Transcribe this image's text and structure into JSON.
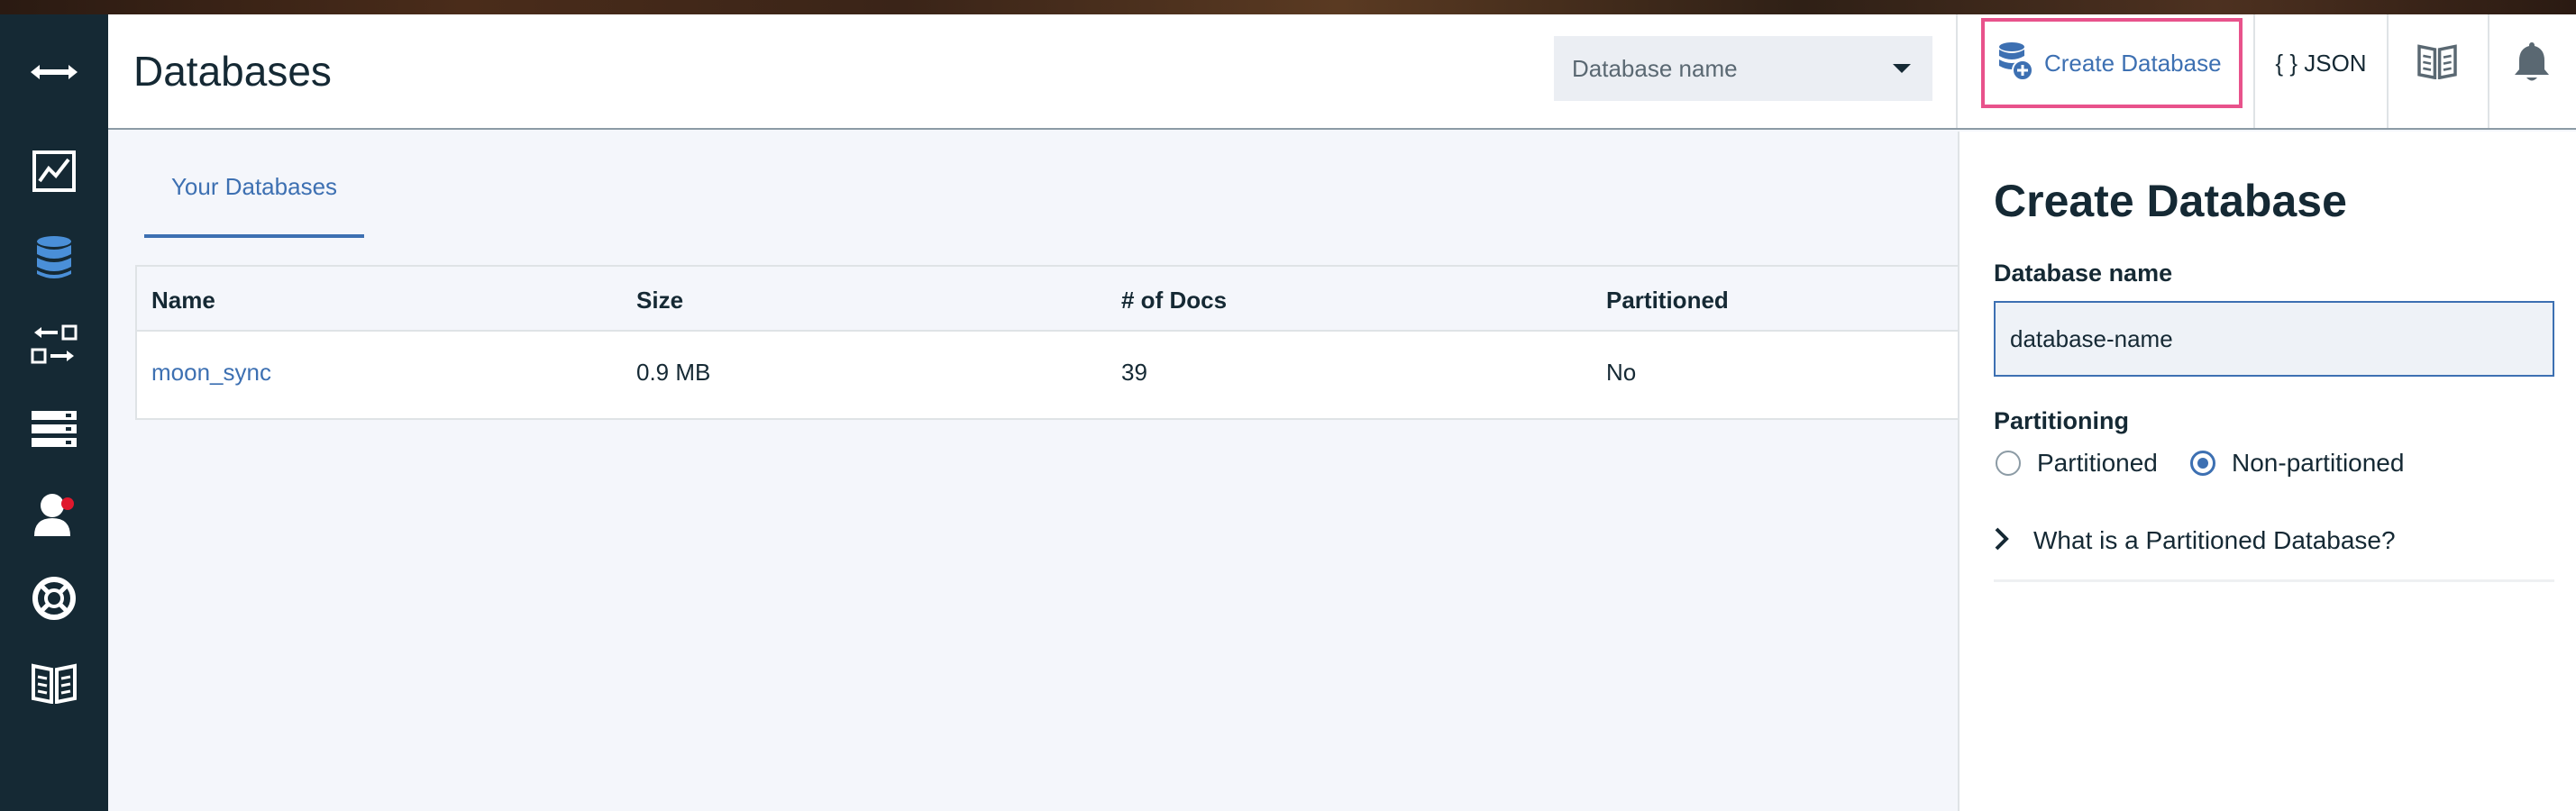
{
  "app": {
    "page_title": "Databases"
  },
  "nav": {
    "items": [
      {
        "icon": "expand-arrows-icon"
      },
      {
        "icon": "monitoring-chart-icon"
      },
      {
        "icon": "databases-icon",
        "active": true
      },
      {
        "icon": "replication-icon"
      },
      {
        "icon": "server-rack-icon"
      },
      {
        "icon": "user-account-icon",
        "notification": true
      },
      {
        "icon": "lifebuoy-support-icon"
      },
      {
        "icon": "documentation-book-icon"
      }
    ]
  },
  "header": {
    "db_select_placeholder": "Database name",
    "create_db_label": "Create Database",
    "json_label": "{ } JSON",
    "colors": {
      "accent": "#3d70b2",
      "highlight_border": "#e8528b",
      "nav_bg": "#152934"
    }
  },
  "main": {
    "tabs": [
      {
        "label": "Your Databases",
        "active": true
      }
    ],
    "table": {
      "headers": [
        "Name",
        "Size",
        "# of Docs",
        "Partitioned"
      ],
      "rows": [
        [
          "moon_sync",
          "0.9 MB",
          "39",
          "No"
        ]
      ]
    }
  },
  "tray": {
    "title": "Create Database",
    "name_label": "Database name",
    "name_value": "database-name",
    "partitioning_label": "Partitioning",
    "options": [
      {
        "label": "Partitioned",
        "checked": false
      },
      {
        "label": "Non-partitioned",
        "checked": true
      }
    ],
    "accordion_label": "What is a Partitioned Database?"
  }
}
